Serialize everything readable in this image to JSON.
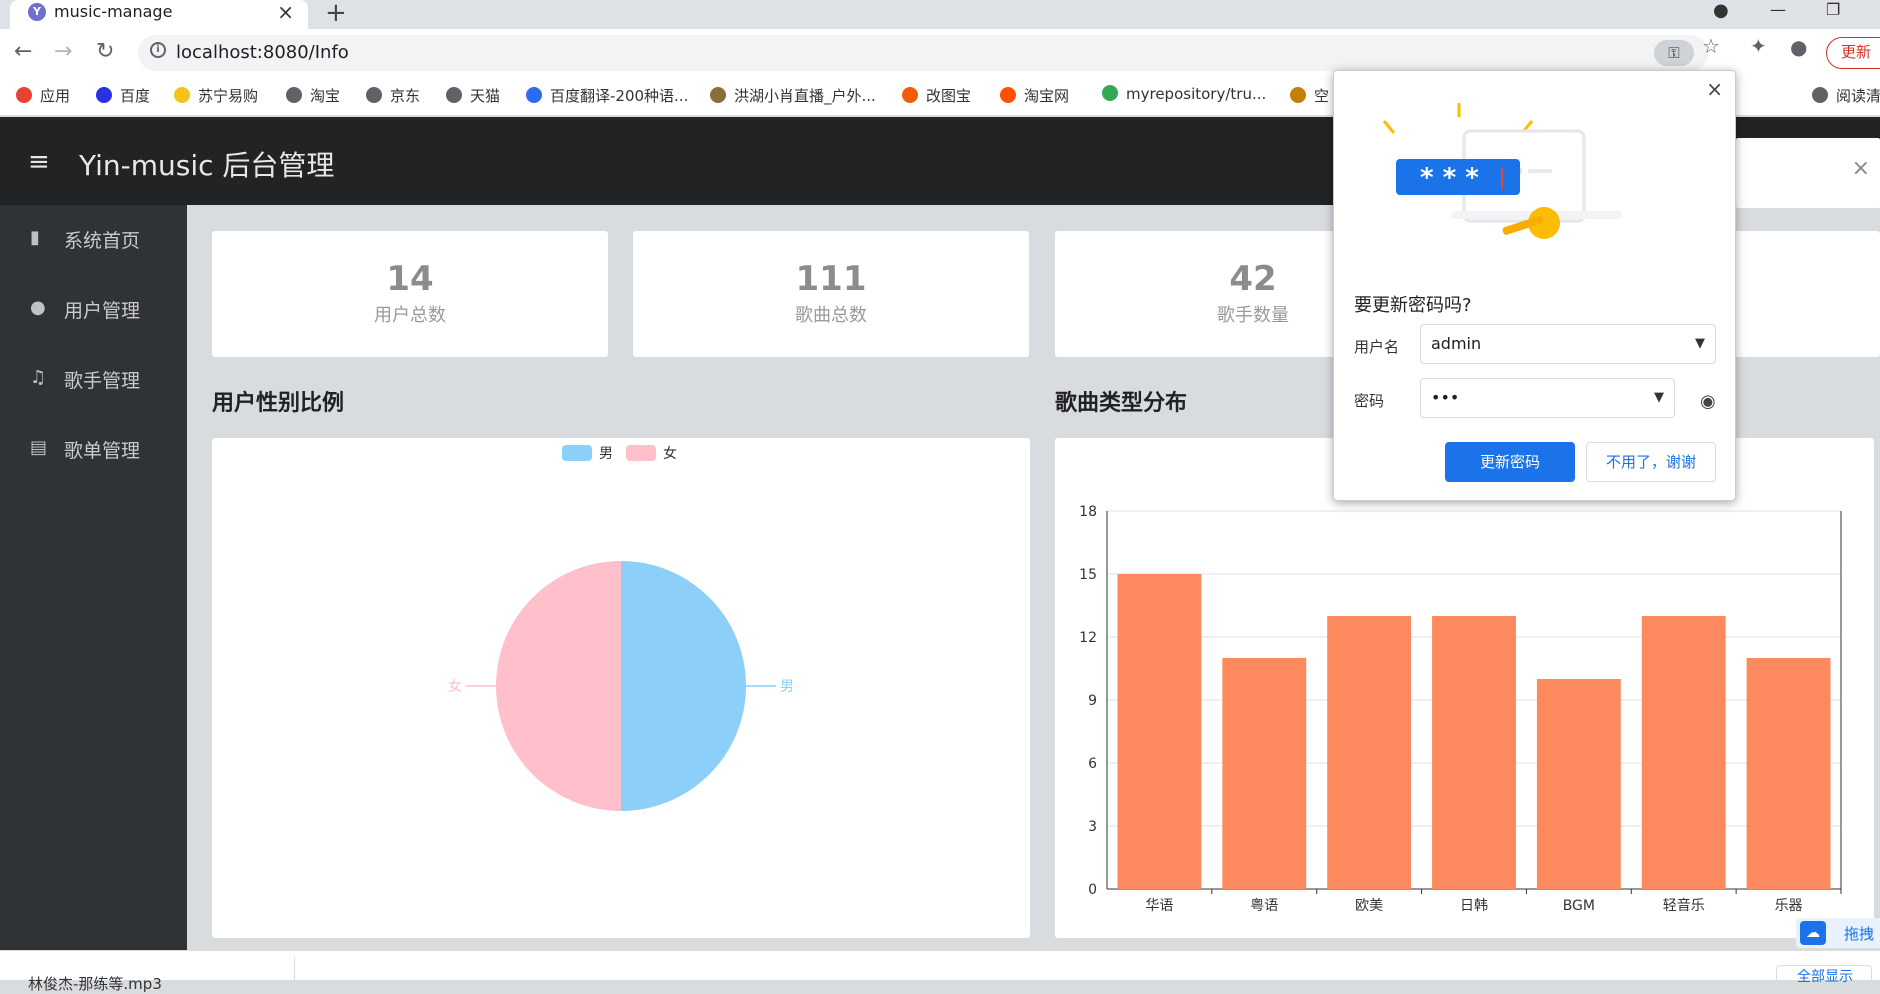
{
  "browser": {
    "tab_title": "music-manage",
    "tab_favicon": "Y",
    "url": "localhost:8080/Info",
    "update_label": "更新",
    "bookmarks": [
      {
        "label": "应用",
        "color": "#e94235"
      },
      {
        "label": "百度",
        "color": "#2932e1"
      },
      {
        "label": "苏宁易购",
        "color": "#f8c21c"
      },
      {
        "label": "淘宝",
        "color": "#5f6368"
      },
      {
        "label": "京东",
        "color": "#5f6368"
      },
      {
        "label": "天猫",
        "color": "#5f6368"
      },
      {
        "label": "百度翻译-200种语...",
        "color": "#2a6df4"
      },
      {
        "label": "洪湖小肖直播_户外...",
        "color": "#8a6d3b"
      },
      {
        "label": "改图宝",
        "color": "#f25c05"
      },
      {
        "label": "淘宝网",
        "color": "#ff5000"
      },
      {
        "label": "myrepository/tru...",
        "color": "#34a853"
      },
      {
        "label": "空",
        "color": "#c77d0a"
      },
      {
        "label": "阅读清",
        "color": "#5f6368"
      }
    ]
  },
  "app": {
    "title": "Yin-music 后台管理",
    "sidebar": [
      {
        "label": "系统首页",
        "icon": "bar-chart-icon"
      },
      {
        "label": "用户管理",
        "icon": "user-icon"
      },
      {
        "label": "歌手管理",
        "icon": "headphones-icon"
      },
      {
        "label": "歌单管理",
        "icon": "document-icon"
      }
    ],
    "stats": [
      {
        "value": "14",
        "label": "用户总数"
      },
      {
        "value": "111",
        "label": "歌曲总数"
      },
      {
        "value": "42",
        "label": "歌手数量"
      }
    ],
    "sections": {
      "gender": "用户性别比例",
      "genre": "歌曲类型分布"
    }
  },
  "chart_data": [
    {
      "type": "pie",
      "legend": [
        "男",
        "女"
      ],
      "legend_position": "top-center",
      "slices": [
        {
          "name": "男",
          "value": 7,
          "color": "#8ccff8"
        },
        {
          "name": "女",
          "value": 7,
          "color": "#ffc0cb"
        }
      ]
    },
    {
      "type": "bar",
      "categories": [
        "华语",
        "粤语",
        "欧美",
        "日韩",
        "BGM",
        "轻音乐",
        "乐器"
      ],
      "values": [
        15,
        11,
        13,
        13,
        10,
        13,
        11
      ],
      "ylim": [
        0,
        18
      ],
      "yticks": [
        0,
        3,
        6,
        9,
        12,
        15,
        18
      ],
      "grid": true,
      "bar_color": "#fd8a5e"
    }
  ],
  "password_popup": {
    "heading": "要更新密码吗?",
    "username_label": "用户名",
    "username_value": "admin",
    "password_label": "密码",
    "password_value": "•••",
    "primary_button": "更新密码",
    "secondary_button": "不用了，谢谢"
  },
  "bottom": {
    "download_item": "林俊杰-那练等.mp3",
    "show_all": "全部显示",
    "float_label": "拖拽"
  }
}
